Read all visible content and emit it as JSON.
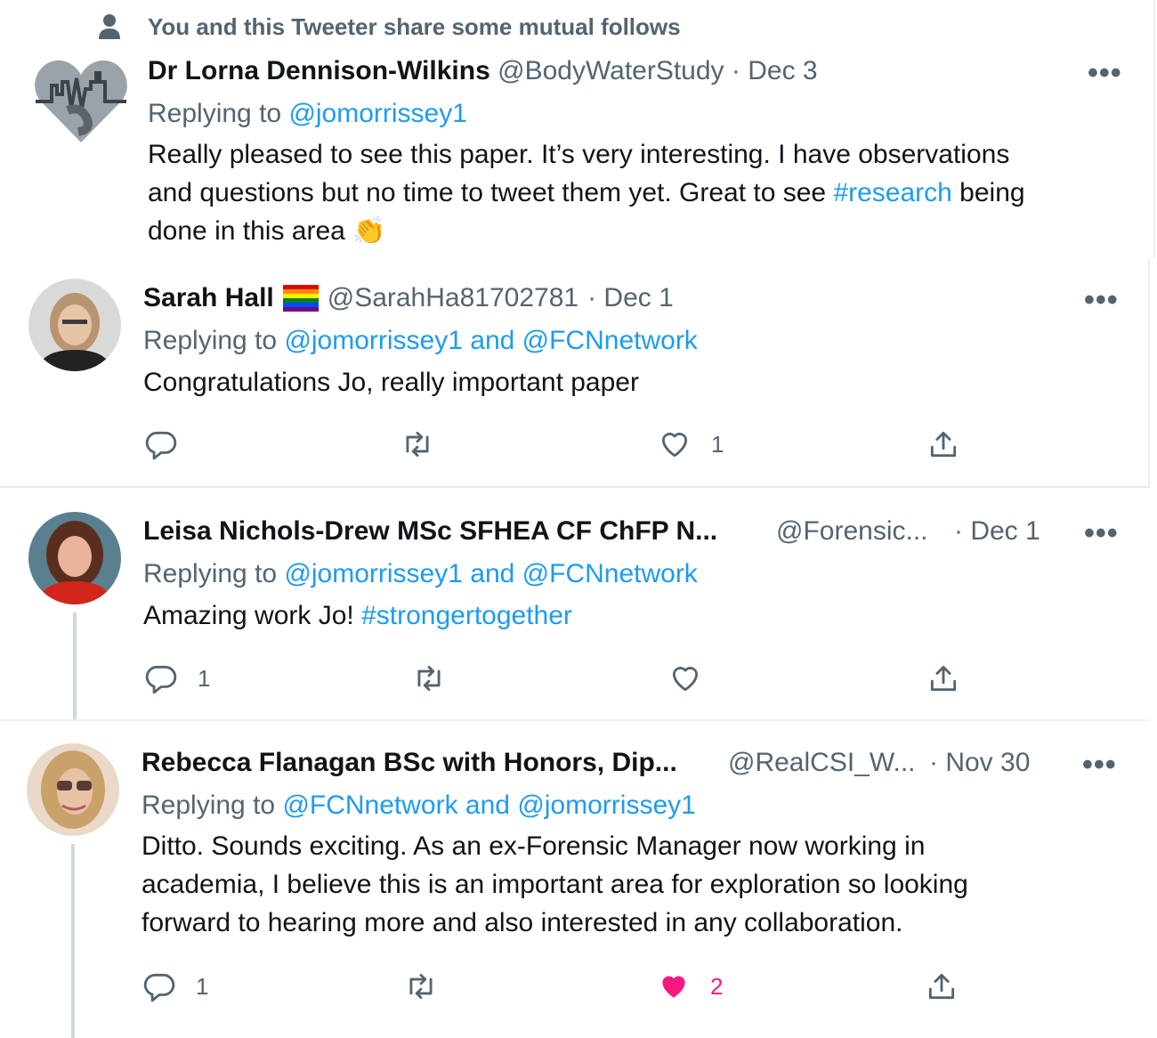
{
  "social_context": {
    "text": "You and this Tweeter share some mutual follows",
    "icon": "person-icon"
  },
  "tweets": [
    {
      "name": "Dr Lorna Dennison-Wilkins",
      "handle": "@BodyWaterStudy",
      "date": "· Dec 3",
      "replying_label": "Replying to",
      "replying_to": "@jomorrissey1",
      "text_1": "Really pleased to see this paper. It’s very interesting. I have observations",
      "text_2a": "and questions but no time to tweet them yet. Great to see ",
      "hashtag": "#research",
      "text_2b": " being",
      "text_3": "done in this area",
      "emoji": "👏"
    },
    {
      "name": "Sarah Hall",
      "flag": "rainbow-flag",
      "handle": "@SarahHa81702781",
      "date": "· Dec 1",
      "replying_label": "Replying to",
      "replying_to": "@jomorrissey1 and @FCNnetwork",
      "text": "Congratulations Jo, really important paper",
      "reply_count": "",
      "like_count": "1"
    },
    {
      "name": "Leisa Nichols-Drew MSc SFHEA CF ChFP N...",
      "handle": "@Forensic...",
      "date": "· Dec 1",
      "replying_label": "Replying to",
      "replying_to": "@jomorrissey1 and @FCNnetwork",
      "text": "Amazing work Jo! ",
      "hashtag": "#strongertogether",
      "reply_count": "1",
      "like_count": ""
    },
    {
      "name": "Rebecca Flanagan BSc with Honors, Dip...",
      "handle": "@RealCSI_W...",
      "date": "· Nov 30",
      "replying_label": "Replying to",
      "replying_to": "@FCNnetwork and @jomorrissey1",
      "text_1": "Ditto. Sounds exciting. As an ex-Forensic Manager now working in",
      "text_2": "academia, I believe this is an important area for exploration so looking",
      "text_3": "forward to hearing more and also interested in any collaboration.",
      "reply_count": "1",
      "like_count": "2",
      "liked": true
    }
  ],
  "more_label": "•••",
  "colors": {
    "link": "#1d9bf0",
    "muted": "#536471",
    "like_active": "#f91880"
  }
}
